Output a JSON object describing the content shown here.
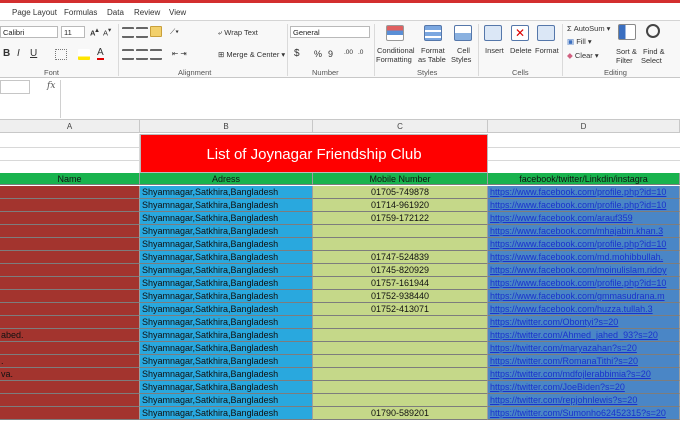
{
  "menu": {
    "tabs": [
      "Page Layout",
      "Formulas",
      "Data",
      "Review",
      "View"
    ]
  },
  "ribbon": {
    "font": {
      "font_name": "Calibri",
      "font_size": "11",
      "group_label": "Font",
      "bold": "B",
      "italic": "I",
      "underline": "U"
    },
    "alignment": {
      "wrap_text": "Wrap Text",
      "merge_center": "Merge & Center",
      "group_label": "Alignment"
    },
    "number": {
      "format": "General",
      "currency": "$",
      "percent": "%",
      "comma": "9",
      "group_label": "Number"
    },
    "styles": {
      "conditional": [
        "Conditional",
        "Formatting"
      ],
      "format_table": [
        "Format",
        "as Table"
      ],
      "cell_styles": [
        "Cell",
        "Styles"
      ],
      "group_label": "Styles"
    },
    "cells": {
      "insert": "Insert",
      "delete": "Delete",
      "format": "Format",
      "group_label": "Cells"
    },
    "editing": {
      "autosum": "AutoSum",
      "fill": "Fill",
      "clear": "Clear",
      "sort_filter": [
        "Sort &",
        "Filter"
      ],
      "find_select": [
        "Find &",
        "Select"
      ],
      "group_label": "Editing"
    }
  },
  "formula_bar": {
    "fx": "fx",
    "value": ""
  },
  "columns": [
    "A",
    "B",
    "C",
    "D"
  ],
  "sheet": {
    "title": "List of Joynagar Friendship Club",
    "headers": {
      "name": "Name",
      "address": "Adress",
      "mobile": "Mobile Number",
      "social": "facebook/twitter/Linkdin/instagra"
    },
    "rows": [
      {
        "name": "",
        "address": "Shyamnagar,Satkhira,Bangladesh",
        "mobile": "01705-749878",
        "social": "https://www.facebook.com/profile.php?id=10"
      },
      {
        "name": "",
        "address": "Shyamnagar,Satkhira,Bangladesh",
        "mobile": "01714-961920",
        "social": "https://www.facebook.com/profile.php?id=10"
      },
      {
        "name": "",
        "address": "Shyamnagar,Satkhira,Bangladesh",
        "mobile": "01759-172122",
        "social": "https://www.facebook.com/arauf359"
      },
      {
        "name": "",
        "address": "Shyamnagar,Satkhira,Bangladesh",
        "mobile": "",
        "social": "https://www.facebook.com/mhajabin.khan.3"
      },
      {
        "name": "",
        "address": "Shyamnagar,Satkhira,Bangladesh",
        "mobile": "",
        "social": "https://www.facebook.com/profile.php?id=10"
      },
      {
        "name": "",
        "address": "Shyamnagar,Satkhira,Bangladesh",
        "mobile": "01747-524839",
        "social": "https://www.facebook.com/md.mohibbullah."
      },
      {
        "name": "",
        "address": "Shyamnagar,Satkhira,Bangladesh",
        "mobile": "01745-820929",
        "social": "https://www.facebook.com/moinulislam.ridoy"
      },
      {
        "name": "",
        "address": "Shyamnagar,Satkhira,Bangladesh",
        "mobile": "01757-161944",
        "social": "https://www.facebook.com/profile.php?id=10"
      },
      {
        "name": "",
        "address": "Shyamnagar,Satkhira,Bangladesh",
        "mobile": "01752-938440",
        "social": "https://www.facebook.com/gmmasudrana.m"
      },
      {
        "name": "",
        "address": "Shyamnagar,Satkhira,Bangladesh",
        "mobile": "01752-413071",
        "social": "https://www.facebook.com/huzza.tullah.3"
      },
      {
        "name": "",
        "address": "Shyamnagar,Satkhira,Bangladesh",
        "mobile": "",
        "social": "https://twitter.com/Obontyi?s=20"
      },
      {
        "name": "abed.",
        "address": "Shyamnagar,Satkhira,Bangladesh",
        "mobile": "",
        "social": "https://twitter.com/Ahmed_jahed_93?s=20"
      },
      {
        "name": "",
        "address": "Shyamnagar,Satkhira,Bangladesh",
        "mobile": "",
        "social": "https://twitter.com/maryazahan?s=20"
      },
      {
        "name": ".",
        "address": "Shyamnagar,Satkhira,Bangladesh",
        "mobile": "",
        "social": "https://twitter.com/RomanaTithi?s=20"
      },
      {
        "name": "va.",
        "address": "Shyamnagar,Satkhira,Bangladesh",
        "mobile": "",
        "social": "https://twitter.com/mdfojlerabbimia?s=20"
      },
      {
        "name": "",
        "address": "Shyamnagar,Satkhira,Bangladesh",
        "mobile": "",
        "social": "https://twitter.com/JoeBiden?s=20"
      },
      {
        "name": "",
        "address": "Shyamnagar,Satkhira,Bangladesh",
        "mobile": "",
        "social": "https://twitter.com/repjohnlewis?s=20"
      },
      {
        "name": "",
        "address": "Shyamnagar,Satkhira,Bangladesh",
        "mobile": "01790-589201",
        "social": "https://twitter.com/Sumonho62452315?s=20"
      }
    ]
  },
  "colors": {
    "title_bg": "#ff0000",
    "header_bg": "#19b34e",
    "col_a_bg": "#a3342e",
    "col_b_bg": "#29a8de",
    "col_c_bg": "#c5d889",
    "col_d_bg": "#4a86c6"
  }
}
